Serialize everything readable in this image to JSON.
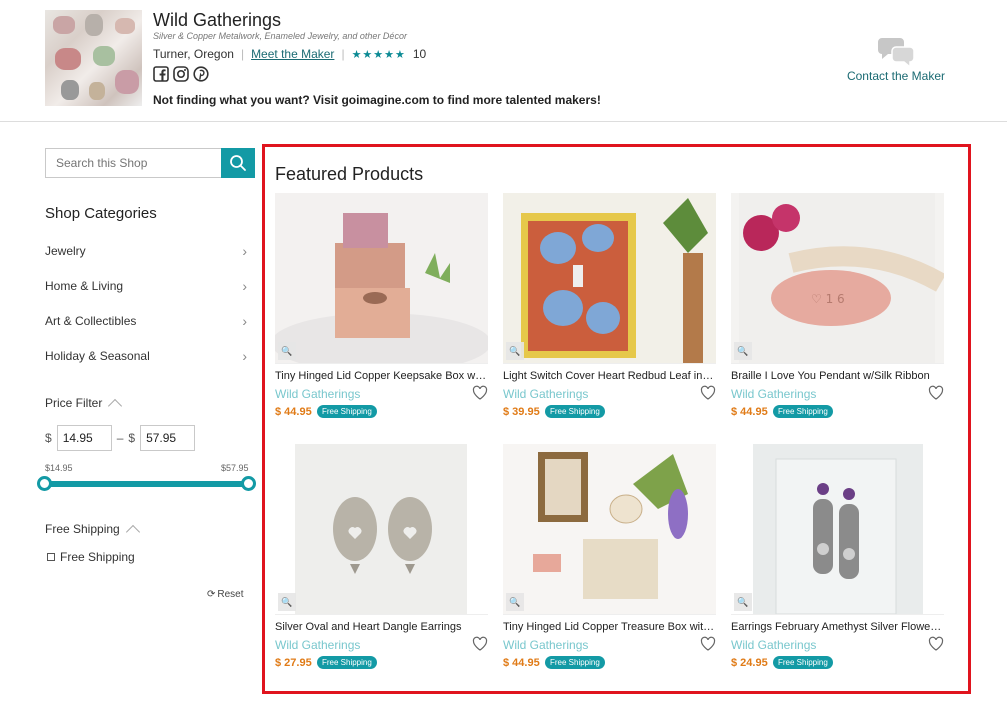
{
  "shop": {
    "name": "Wild Gatherings",
    "tagline": "Silver & Copper Metalwork, Enameled Jewelry, and other Décor",
    "location": "Turner, Oregon",
    "meet_label": "Meet the Maker",
    "rating_stars": "★★★★★",
    "rating_count": "10",
    "not_finding": "Not finding what you want? Visit goimagine.com to find more talented makers!",
    "contact_label": "Contact the Maker",
    "social_icons": [
      "facebook-icon",
      "instagram-icon",
      "pinterest-icon"
    ]
  },
  "sidebar": {
    "search_placeholder": "Search this Shop",
    "categories_title": "Shop Categories",
    "categories": [
      {
        "label": "Jewelry"
      },
      {
        "label": "Home & Living"
      },
      {
        "label": "Art & Collectibles"
      },
      {
        "label": "Holiday & Seasonal"
      }
    ],
    "price_filter": {
      "title": "Price Filter",
      "currency": "$",
      "dash": "–",
      "min_value": "14.95",
      "max_value": "57.95",
      "range_min_label": "$14.95",
      "range_max_label": "$57.95"
    },
    "free_shipping": {
      "title": "Free Shipping",
      "checkbox_label": "Free Shipping"
    },
    "reset_label": "Reset"
  },
  "featured": {
    "title": "Featured Products",
    "products": [
      {
        "title": "Tiny Hinged Lid Copper Keepsake Box with J...",
        "shop": "Wild Gatherings",
        "price": "$ 44.95",
        "badge": "Free Shipping"
      },
      {
        "title": "Light Switch Cover Heart Redbud Leaf in Co...",
        "shop": "Wild Gatherings",
        "price": "$ 39.95",
        "badge": "Free Shipping"
      },
      {
        "title": "Braille I Love You Pendant w/Silk Ribbon",
        "shop": "Wild Gatherings",
        "price": "$ 44.95",
        "badge": "Free Shipping"
      },
      {
        "title": "Silver Oval and Heart Dangle Earrings",
        "shop": "Wild Gatherings",
        "price": "$ 27.95",
        "badge": "Free Shipping"
      },
      {
        "title": "Tiny Hinged Lid Copper Treasure Box with O...",
        "shop": "Wild Gatherings",
        "price": "$ 44.95",
        "badge": "Free Shipping"
      },
      {
        "title": "Earrings February Amethyst Silver Flower Dr...",
        "shop": "Wild Gatherings",
        "price": "$ 24.95",
        "badge": "Free Shipping"
      }
    ]
  },
  "colors": {
    "accent": "#139aa5",
    "price": "#e07b17",
    "shop_link": "#79c7cd",
    "highlight_frame": "#e0141e"
  }
}
